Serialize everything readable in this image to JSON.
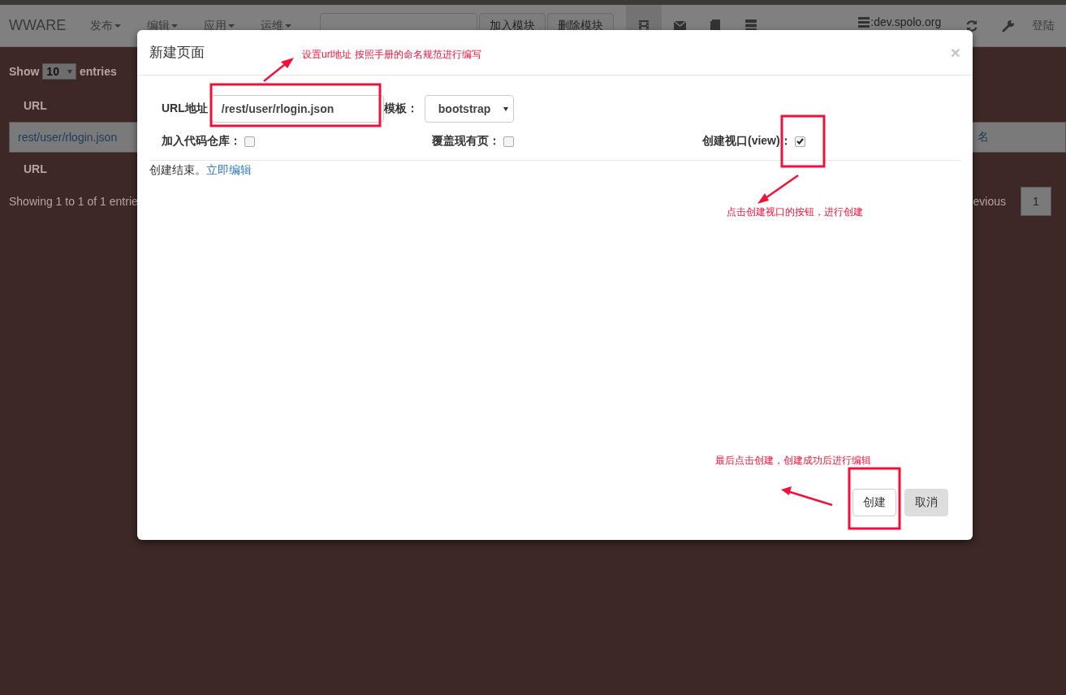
{
  "navbar": {
    "brand": "WWARE",
    "menus": [
      {
        "label": "发布"
      },
      {
        "label": "编辑"
      },
      {
        "label": "应用"
      },
      {
        "label": "运维"
      }
    ],
    "buttons": [
      "加入模块",
      "删除模块"
    ],
    "tools": [
      {
        "kind": "film",
        "selected": true
      },
      {
        "kind": "envelope",
        "selected": false
      },
      {
        "kind": "book",
        "selected": false
      },
      {
        "kind": "server",
        "selected": false
      }
    ],
    "host": ":dev.spolo.org",
    "login": "登陆"
  },
  "table": {
    "show_label": "Show",
    "length": "10",
    "entries_label": "entries",
    "header": "URL",
    "rows": [
      {
        "url": "rest/user/rlogin.json",
        "column_2": "名"
      }
    ],
    "footer": "URL",
    "info": "Showing 1 to 1 of 1 entrie",
    "previous": "evious",
    "page": "1"
  },
  "modal": {
    "title": "新建页面",
    "close": "×",
    "url_label": "URL地址",
    "url_value": "/rest/user/rlogin.json",
    "template_label": "模板：",
    "template_value": "bootstrap",
    "options": [
      {
        "label": "加入代码仓库：",
        "checked": false
      },
      {
        "label": "覆盖现有页：",
        "checked": false
      },
      {
        "label": "创建视口(view)：",
        "checked": true
      }
    ],
    "status": "创建结束。",
    "status_link": "立即编辑",
    "buttons": [
      {
        "label": "创建",
        "kind": "default"
      },
      {
        "label": "取消",
        "kind": "muted"
      }
    ]
  },
  "annotations": [
    {
      "text": "设置url地址 按照手册的命名规范进行编写"
    },
    {
      "text": "点击创建视口的按钮，进行创建"
    },
    {
      "text": "最后点击创建，创建成功后进行编辑"
    }
  ]
}
